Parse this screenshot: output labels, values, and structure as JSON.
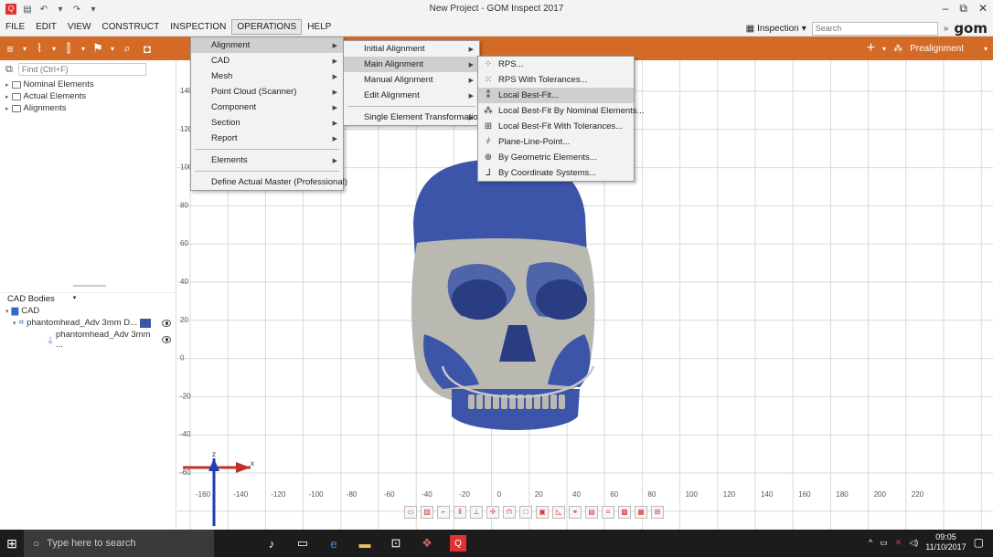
{
  "window": {
    "title": "New Project - GOM Inspect 2017",
    "controls": [
      "–",
      "⧉",
      "✕"
    ]
  },
  "menubar": {
    "items": [
      "FILE",
      "EDIT",
      "VIEW",
      "CONSTRUCT",
      "INSPECTION",
      "OPERATIONS",
      "HELP"
    ],
    "active": "OPERATIONS",
    "mode": "Inspection",
    "search_placeholder": "Search",
    "logo": "gom"
  },
  "toolbar": {
    "prealignment_label": "Prealignment"
  },
  "left_panel": {
    "find_placeholder": "Find (Ctrl+F)",
    "tree": [
      {
        "label": "Nominal Elements"
      },
      {
        "label": "Actual Elements"
      },
      {
        "label": "Alignments"
      }
    ],
    "cad_header": "CAD Bodies",
    "cad_root": "CAD",
    "cad_items": [
      {
        "label": "phantomhead_Adv 3mm D..."
      },
      {
        "label": "phantomhead_Adv 3mm ..."
      }
    ]
  },
  "menus": {
    "operations": {
      "items": [
        "Alignment",
        "CAD",
        "Mesh",
        "Point Cloud (Scanner)",
        "Component",
        "Section",
        "Report",
        "Elements",
        "Define Actual Master (Professional)"
      ],
      "highlighted": "Alignment"
    },
    "alignment": {
      "items": [
        "Initial Alignment",
        "Main Alignment",
        "Manual Alignment",
        "Edit Alignment",
        "Single Element Transformation"
      ],
      "highlighted": "Main Alignment"
    },
    "main_alignment": {
      "items": [
        "RPS...",
        "RPS With Tolerances...",
        "Local Best-Fit...",
        "Local Best-Fit By Nominal Elements...",
        "Local Best-Fit With Tolerances...",
        "Plane-Line-Point...",
        "By Geometric Elements...",
        "By Coordinate Systems..."
      ],
      "highlighted": "Local Best-Fit..."
    }
  },
  "viewport": {
    "y_ticks": [
      "140",
      "120",
      "100",
      "80",
      "60",
      "40",
      "20",
      "0",
      "-20",
      "-40",
      "-60"
    ],
    "x_ticks": [
      "-160",
      "-140",
      "-120",
      "-100",
      "-80",
      "-60",
      "-40",
      "-20",
      "0",
      "20",
      "40",
      "60",
      "80",
      "100",
      "120",
      "140",
      "160",
      "180",
      "200",
      "220"
    ],
    "axis_z": "z",
    "axis_x": "x",
    "colors": {
      "mesh_blue": "#3d55a8",
      "mesh_grey": "#b9b9b2",
      "grid": "#d9d9d9",
      "axis_red": "#c0302a",
      "axis_blue": "#1f3fb0"
    }
  },
  "taskbar": {
    "search_placeholder": "Type here to search",
    "time": "09:05",
    "date": "11/10/2017"
  }
}
